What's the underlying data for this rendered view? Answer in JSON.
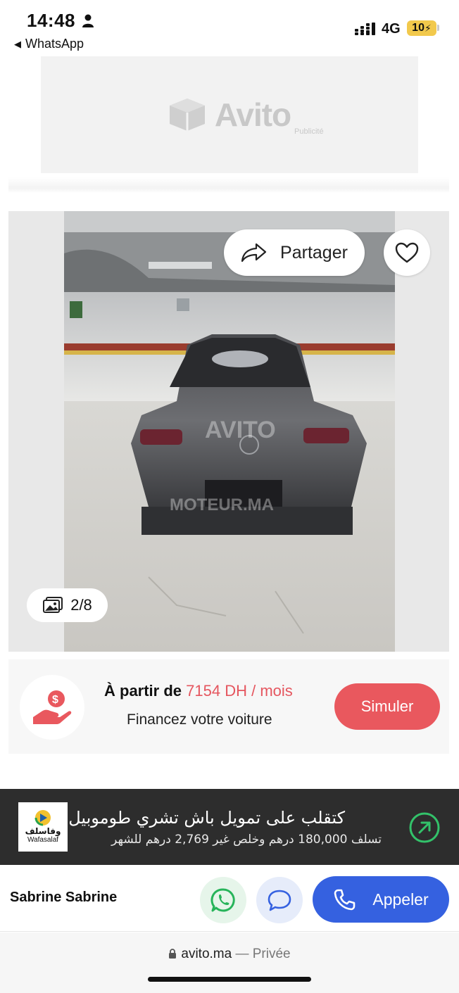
{
  "status_bar": {
    "time": "14:48",
    "back_app": "WhatsApp",
    "network": "4G",
    "battery": "10"
  },
  "ad": {
    "brand": "Avito",
    "label": "Publicité"
  },
  "gallery": {
    "share_label": "Partager",
    "counter": "2/8",
    "watermarks": [
      "AVITO",
      "MOTEUR.MA"
    ]
  },
  "finance": {
    "prefix": "À partir de",
    "price": "7154 DH / mois",
    "subtitle": "Financez votre voiture",
    "button": "Simuler",
    "accent_color": "#e9585e"
  },
  "wafasalaf": {
    "logo_ar": "وفاسلف",
    "logo_latin": "Wafasalaf",
    "title": "كتقلب على تمويل باش تشري طوموبيل ؟",
    "subtitle": "تسلف 180,000 درهم وخلص غير 2,769 درهم للشهر"
  },
  "contact": {
    "seller_name": "Sabrine Sabrine",
    "call_label": "Appeler",
    "call_color": "#3561e0"
  },
  "browser": {
    "domain": "avito.ma",
    "separator": " — ",
    "mode": "Privée"
  }
}
